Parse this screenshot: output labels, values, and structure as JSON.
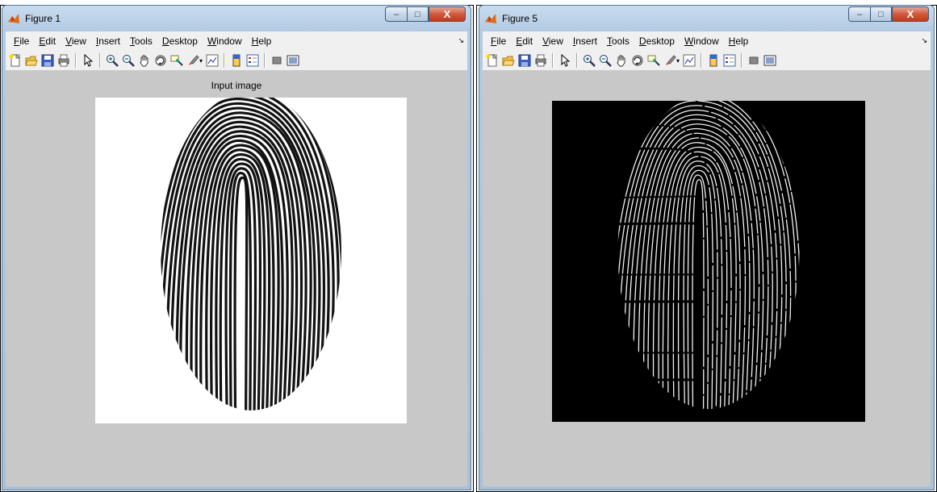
{
  "figures": [
    {
      "window_title": "Figure 1",
      "menu": [
        {
          "label": "File",
          "u": "F",
          "rest": "ile"
        },
        {
          "label": "Edit",
          "u": "E",
          "rest": "dit"
        },
        {
          "label": "View",
          "u": "V",
          "rest": "iew"
        },
        {
          "label": "Insert",
          "u": "I",
          "rest": "nsert"
        },
        {
          "label": "Tools",
          "u": "T",
          "rest": "ools"
        },
        {
          "label": "Desktop",
          "u": "D",
          "rest": "esktop"
        },
        {
          "label": "Window",
          "u": "W",
          "rest": "indow"
        },
        {
          "label": "Help",
          "u": "H",
          "rest": "elp"
        }
      ],
      "axes_title": "Input image",
      "image": "fingerprint-grayscale"
    },
    {
      "window_title": "Figure 5",
      "menu": [
        {
          "label": "File",
          "u": "F",
          "rest": "ile"
        },
        {
          "label": "Edit",
          "u": "E",
          "rest": "dit"
        },
        {
          "label": "View",
          "u": "V",
          "rest": "iew"
        },
        {
          "label": "Insert",
          "u": "I",
          "rest": "nsert"
        },
        {
          "label": "Tools",
          "u": "T",
          "rest": "ools"
        },
        {
          "label": "Desktop",
          "u": "D",
          "rest": "esktop"
        },
        {
          "label": "Window",
          "u": "W",
          "rest": "indow"
        },
        {
          "label": "Help",
          "u": "H",
          "rest": "elp"
        }
      ],
      "axes_title": "",
      "image": "fingerprint-skeleton"
    }
  ],
  "icons": [
    "new-figure",
    "open-file",
    "save",
    "print",
    "edit-plot",
    "zoom-in",
    "zoom-out",
    "pan",
    "rotate-3d",
    "data-cursor",
    "brush",
    "link-plot",
    "colorbar",
    "legend",
    "hide-plot-tools",
    "show-plot-tools"
  ],
  "caption_buttons": {
    "minimize": "–",
    "maximize": "□",
    "close": "X"
  },
  "colors": {
    "titlebar": "#b4cbe3",
    "figure_bg": "#c8c8c8",
    "close": "#c2391f",
    "matlab_orange": "#e06a1a"
  }
}
